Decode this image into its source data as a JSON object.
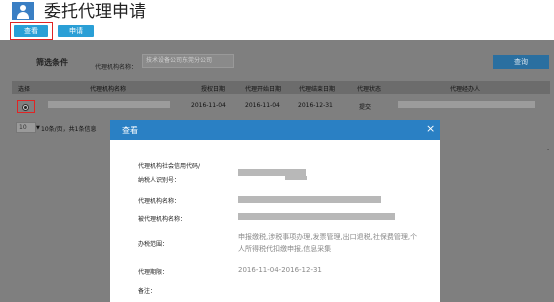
{
  "page": {
    "title": "委托代理申请",
    "tabs": {
      "view": "查看",
      "apply": "申请"
    }
  },
  "filter": {
    "title": "筛选条件",
    "agency_label": "代理机构名称：",
    "agency_value": "技术设备公司东莞分公司",
    "search_label": "查询"
  },
  "table": {
    "headers": [
      "选择",
      "代理机构名称",
      "授权日期",
      "代理开始日期",
      "代理结束日期",
      "代理状态",
      "代理经办人"
    ],
    "rows": [
      {
        "auth_date": "2016-11-04",
        "start_date": "2016-11-04",
        "end_date": "2016-12-31",
        "status": "提交"
      }
    ]
  },
  "pager": {
    "page_size": "10",
    "info": "10条/页，共1条信息"
  },
  "modal": {
    "title": "查看",
    "close": "×",
    "credit_code_label_line1": "代理机构社会信用代码/",
    "credit_code_label_line2": "纳税人识别号：",
    "agency_name_label": "代理机构名称：",
    "delegated_name_label": "被代理机构名称：",
    "scope_label": "办税范围：",
    "scope_value": "申报缴税,涉税事项办理,发票管理,出口退税,社保费管理,个人所得税代扣缴申报,信息采集",
    "period_label": "代理期限：",
    "period_value": "2016-11-04-2016-12-31",
    "remark_label": "备注："
  },
  "colors": {
    "accent": "#2a80c4",
    "tab": "#2a9fd6",
    "highlight": "#e02424"
  }
}
